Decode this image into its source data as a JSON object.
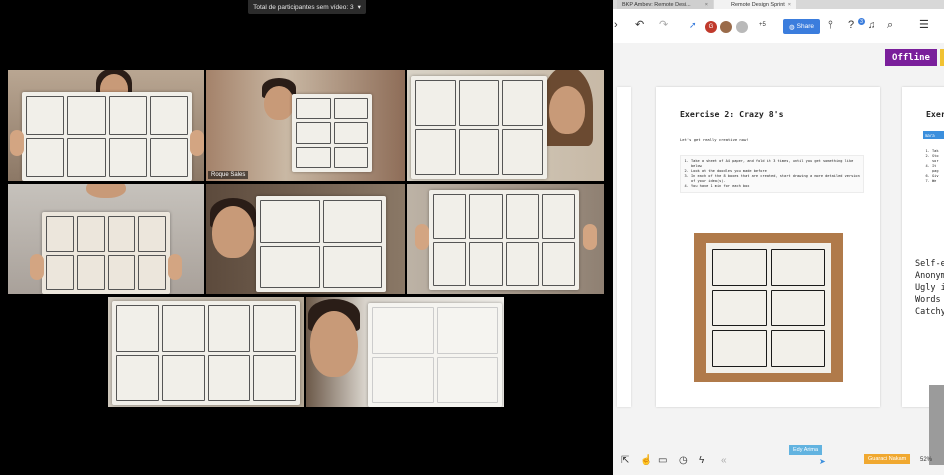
{
  "zoom": {
    "banner": "Total de participantes sem vídeo: 3",
    "participants": [
      {
        "name": ""
      },
      {
        "name": "Roque Sales",
        "active": true
      },
      {
        "name": ""
      },
      {
        "name": ""
      },
      {
        "name": ""
      },
      {
        "name": ""
      },
      {
        "name": ""
      },
      {
        "name": ""
      }
    ]
  },
  "browser": {
    "tabs": [
      {
        "label": "BKP Ambev: Remote Desi..."
      },
      {
        "label": "Remote Design Sprint",
        "active": true
      }
    ],
    "toolbar": {
      "avatars": [
        {
          "initial": "G",
          "color": "#c0392b"
        },
        {
          "initial": "",
          "color": "#9a6b4a"
        },
        {
          "initial": "",
          "color": "#b9b9b9"
        }
      ],
      "extra_count": "+5",
      "share_label": "Share",
      "notification_count": "3"
    },
    "offline_label": "Offline",
    "board": {
      "card": {
        "title": "Exercise 2: Crazy 8's",
        "intro": "Let's get really creative now!",
        "steps": [
          "Take a sheet of A4 paper, and fold it 3 times, until you get something like below",
          "Look at the doodles you made before",
          "In each of the 8 boxes that are created, start drawing a more detailed version of your idea(s).",
          "You have 1 min for each box"
        ]
      },
      "card2": {
        "title": "Exer",
        "pill": "mara",
        "steps": [
          "Tak",
          "Sto",
          "sor",
          "It",
          "pag",
          "Giv",
          "We"
        ]
      },
      "side_list": [
        "Self-e",
        "Anonym",
        "Ugly i",
        "Words",
        "Catchy"
      ]
    },
    "cursors": [
      {
        "label": "Edy Arima",
        "color": "#62b3e0"
      },
      {
        "label": "Guaraci Nakam",
        "color": "#f0a830"
      }
    ],
    "zoom_level": "52%"
  }
}
